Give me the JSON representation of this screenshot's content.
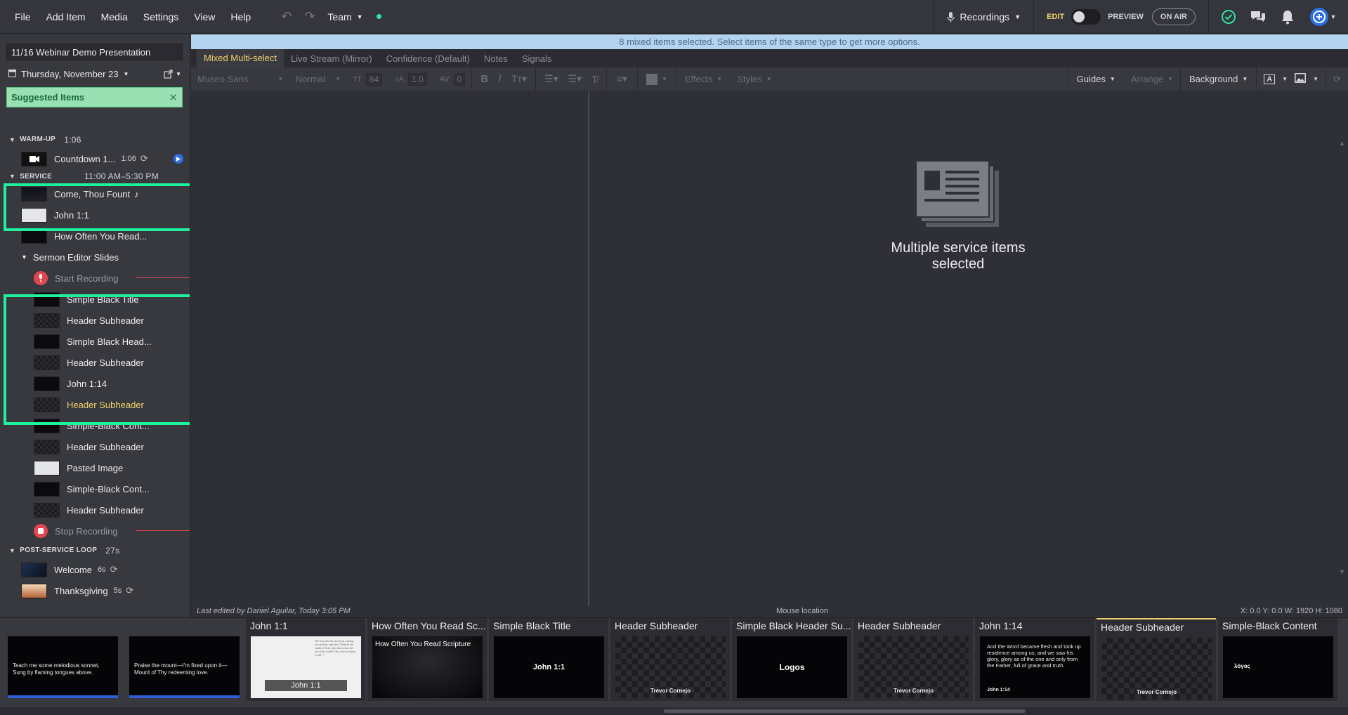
{
  "menu": [
    "File",
    "Add Item",
    "Media",
    "Settings",
    "View",
    "Help"
  ],
  "team": {
    "label": "Team",
    "status_color": "#2ee59d"
  },
  "recordings": {
    "label": "Recordings"
  },
  "mode": {
    "edit": "EDIT",
    "preview": "PREVIEW",
    "on_air": "ON AIR"
  },
  "sidebar": {
    "presentation_title": "11/16 Webinar Demo Presentation",
    "date": "Thursday, November 23",
    "suggested": "Suggested Items",
    "sections": [
      {
        "name": "WARM-UP",
        "time": "1:06"
      },
      {
        "name": "SERVICE",
        "time": "11:00 AM–5:30 PM"
      },
      {
        "name": "POST-SERVICE LOOP",
        "time": "27s"
      }
    ],
    "items": {
      "countdown": {
        "label": "Countdown 1...",
        "meta": "1:06"
      },
      "come_thou": {
        "label": "Come, Thou Fount"
      },
      "john11": {
        "label": "John 1:1"
      },
      "how_often": {
        "label": "How Often You Read..."
      },
      "sermon": {
        "label": "Sermon Editor Slides"
      },
      "start_rec": {
        "label": "Start Recording"
      },
      "sub": [
        "Simple Black Title",
        "Header Subheader",
        "Simple Black Head...",
        "Header Subheader",
        "John 1:14",
        "Header Subheader",
        "Simple-Black Cont...",
        "Header Subheader",
        "Pasted Image",
        "Simple-Black Cont...",
        "Header Subheader"
      ],
      "stop_rec": {
        "label": "Stop Recording"
      },
      "welcome": {
        "label": "Welcome",
        "meta": "6s"
      },
      "thanksgiving": {
        "label": "Thanksgiving",
        "meta": "5s"
      }
    }
  },
  "editor": {
    "info": "8 mixed items selected. Select items of the same type to get more options.",
    "tabs": [
      "Mixed Multi-select",
      "Live Stream  (Mirror)",
      "Confidence (Default)",
      "Notes",
      "Signals"
    ],
    "toolbar": {
      "font": "Museo Sans",
      "weight": "Normal",
      "size": "84",
      "line": "1.0",
      "spacing": "0",
      "effects": "Effects",
      "styles": "Styles",
      "guides": "Guides",
      "arrange": "Arrange",
      "background": "Background"
    },
    "multi_msg": "Multiple service items selected",
    "status": {
      "edited": "Last edited by Daniel Aguilar, Today 3:05 PM",
      "mouse": "Mouse location",
      "coords": "X: 0.0   Y: 0.0     W: 1920   H: 1080"
    }
  },
  "filmstrip": [
    {
      "title": "",
      "text": "Teach me some melodious sonnet,\nSung by flaming tongues above."
    },
    {
      "title": "",
      "text": "Praise the mount—I'm fixed upon it—\nMount of Thy redeeming love."
    },
    {
      "title": "John 1:1",
      "caption": "John 1:1"
    },
    {
      "title": "How Often You Read Sc...",
      "text": "How Often You Read Scripture"
    },
    {
      "title": "Simple Black Title",
      "text": "John 1:1"
    },
    {
      "title": "Header Subheader",
      "footer": "Trevor Cornejo"
    },
    {
      "title": "Simple Black Header Su...",
      "text": "Logos"
    },
    {
      "title": "Header Subheader",
      "footer": "Trevor Cornejo"
    },
    {
      "title": "John 1:14",
      "text": "And the Word became flesh and took up residence among us, and we saw his glory, glory as of the one and only from the Father, full of grace and truth.",
      "ref": "John 1:14"
    },
    {
      "title": "Header Subheader",
      "footer": "Trevor Cornejo"
    },
    {
      "title": "Simple-Black Content",
      "text": "λόγος"
    }
  ]
}
